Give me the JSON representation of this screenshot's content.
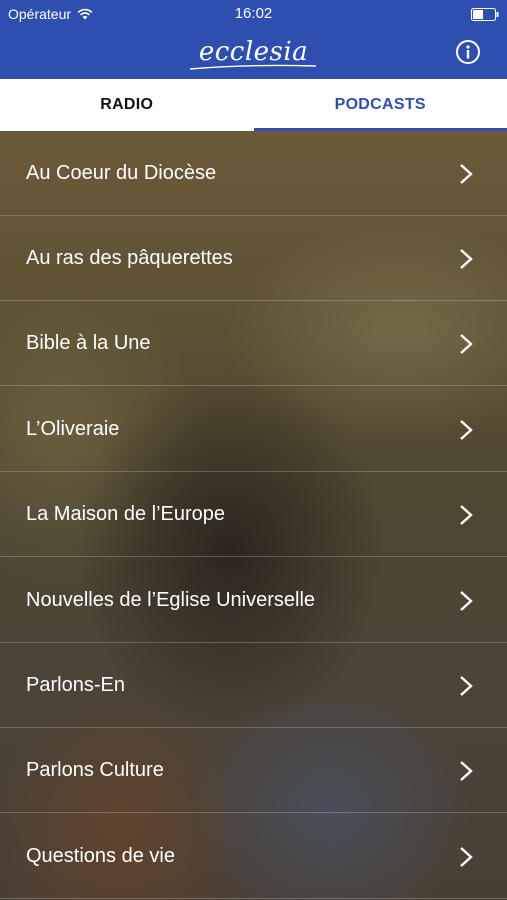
{
  "status_bar": {
    "carrier": "Opérateur",
    "time": "16:02"
  },
  "header": {
    "logo_text": "ecclesia",
    "info_icon": "info-icon"
  },
  "tabs": [
    {
      "label": "RADIO",
      "selected": false
    },
    {
      "label": "PODCASTS",
      "selected": true
    }
  ],
  "list": {
    "items": [
      {
        "label": "Au Coeur du Diocèse"
      },
      {
        "label": "Au ras des pâquerettes"
      },
      {
        "label": "Bible à la Une"
      },
      {
        "label": "L’Oliveraie"
      },
      {
        "label": "La Maison de l’Europe"
      },
      {
        "label": "Nouvelles de l’Eglise Universelle"
      },
      {
        "label": "Parlons-En"
      },
      {
        "label": "Parlons Culture"
      },
      {
        "label": "Questions de vie"
      }
    ]
  },
  "colors": {
    "brand": "#2f4fb0",
    "tab_text": "#111111",
    "row_text": "#ffffff"
  }
}
